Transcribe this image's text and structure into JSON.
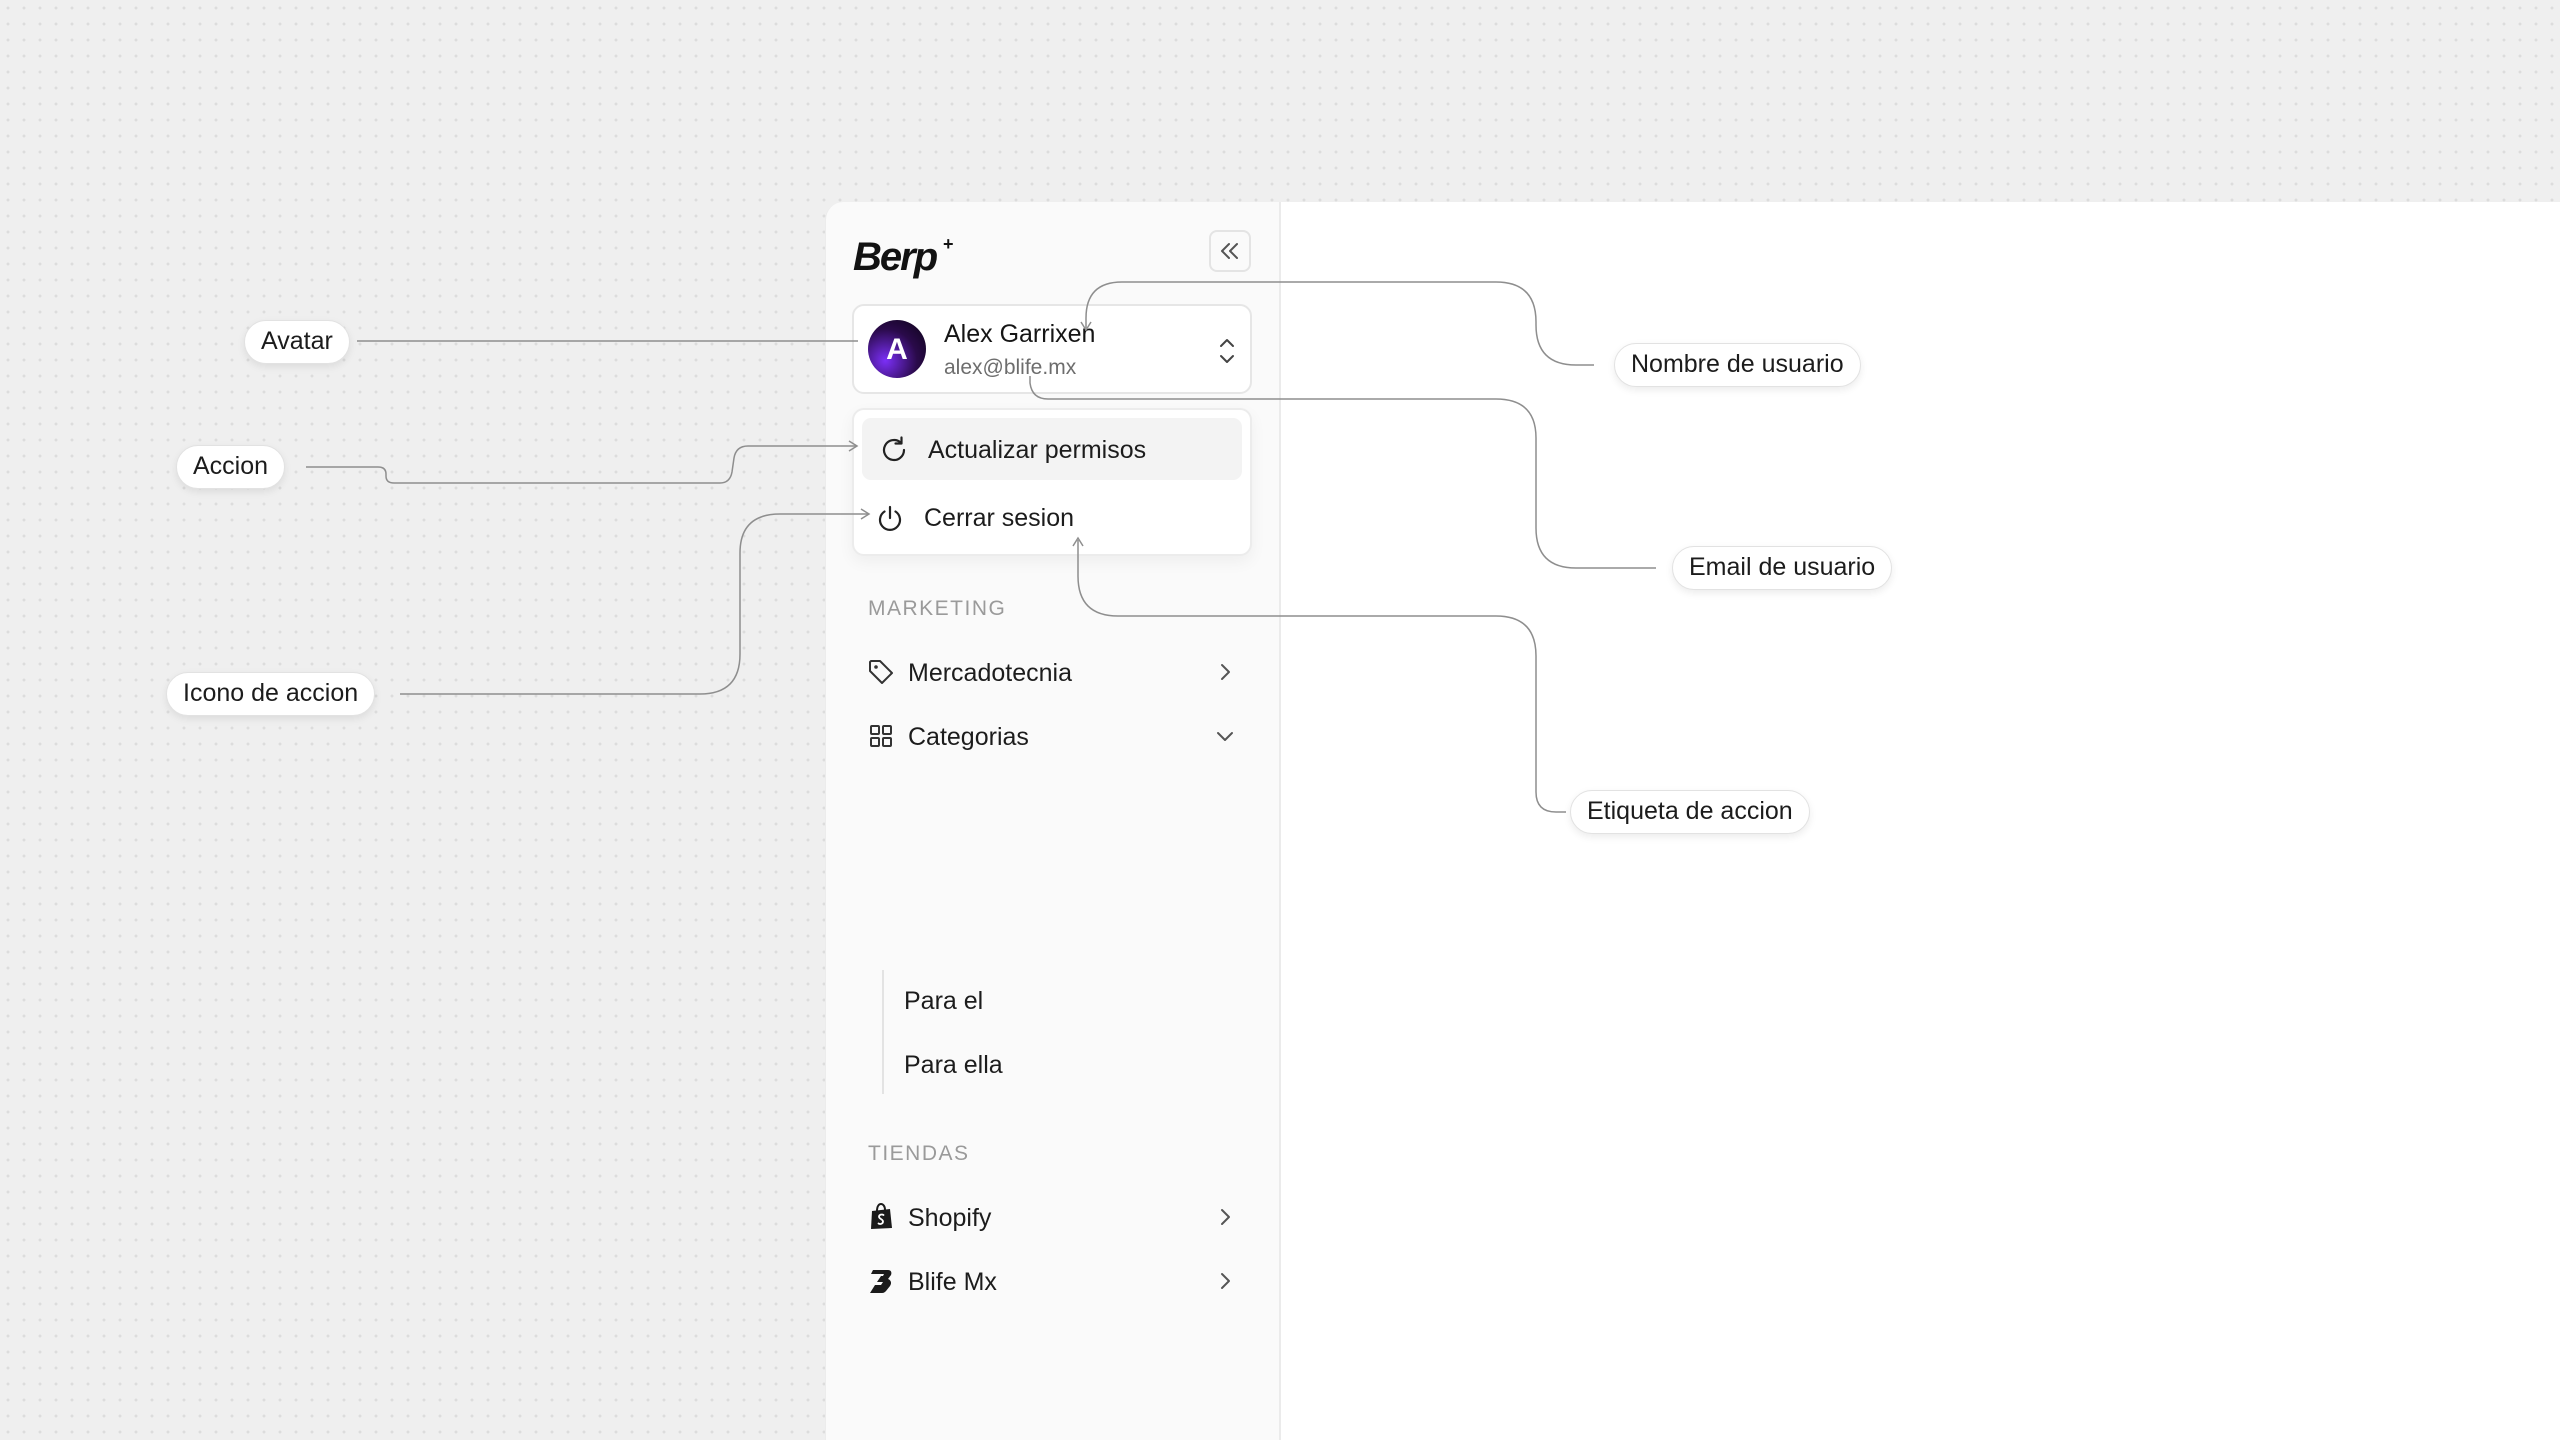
{
  "app": {
    "logo_text": "Berp",
    "logo_mark": "+"
  },
  "user": {
    "avatar_letter": "A",
    "name": "Alex Garrixen",
    "email": "alex@blife.mx"
  },
  "account_menu": {
    "items": [
      {
        "label": "Actualizar permisos",
        "icon": "refresh-icon",
        "active": true
      },
      {
        "label": "Cerrar sesion",
        "icon": "power-icon",
        "active": false
      }
    ]
  },
  "sections": {
    "marketing": {
      "label": "MARKETING",
      "items": [
        {
          "label": "Mercadotecnia",
          "icon": "tag-icon",
          "chevron": "chevron-right-icon"
        },
        {
          "label": "Categorias",
          "icon": "grid-icon",
          "chevron": "chevron-down-icon"
        }
      ],
      "subitems": [
        {
          "label": "Para el"
        },
        {
          "label": "Para ella"
        }
      ]
    },
    "tiendas": {
      "label": "TIENDAS",
      "items": [
        {
          "label": "Shopify",
          "icon": "shopify-bag-icon",
          "chevron": "chevron-right-icon"
        },
        {
          "label": "Blife Mx",
          "icon": "blife-logo-icon",
          "chevron": "chevron-right-icon"
        }
      ]
    }
  },
  "annotations": {
    "avatar": "Avatar",
    "accion": "Accion",
    "icono_de_accion": "Icono de accion",
    "nombre_de_usuario": "Nombre de usuario",
    "email_de_usuario": "Email de usuario",
    "etiqueta_de_accion": "Etiqueta de accion"
  },
  "colors": {
    "background": "#efefef",
    "sidebar": "#fafafa",
    "panel": "#ffffff",
    "avatar_gradient_from": "#7b2ff7",
    "avatar_gradient_to": "#0b0314",
    "muted_text": "#9a9a9a"
  }
}
